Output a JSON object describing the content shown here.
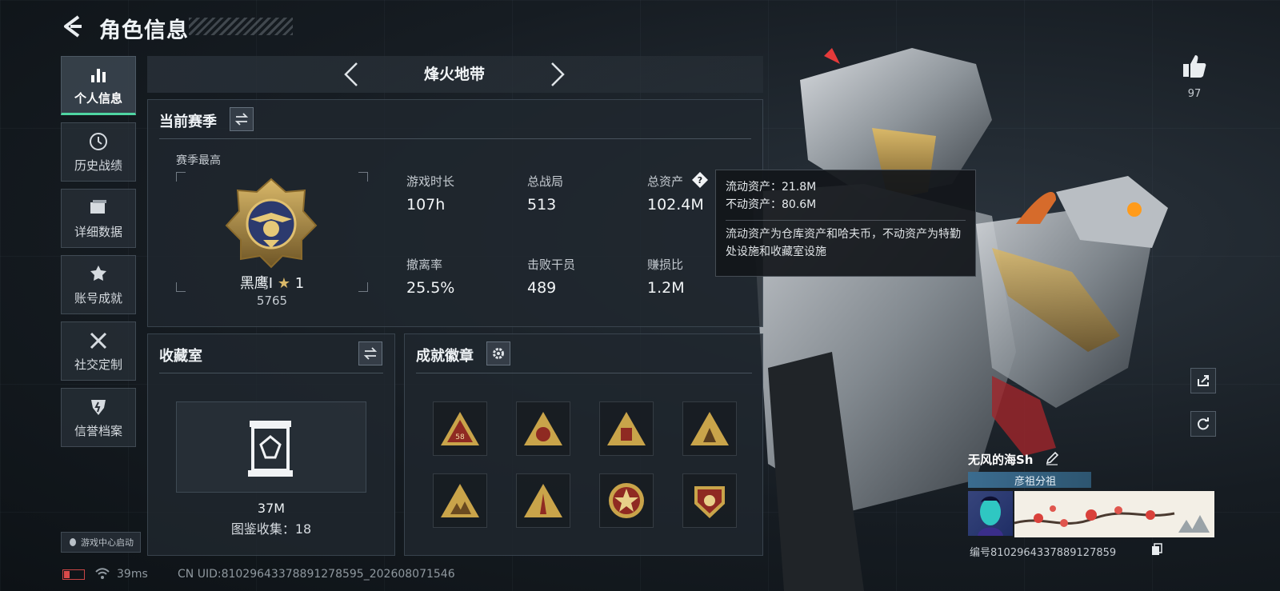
{
  "header": {
    "title": "角色信息"
  },
  "sidebar": {
    "items": [
      {
        "label": "个人信息",
        "icon": "bar-chart-icon",
        "active": true
      },
      {
        "label": "历史战绩",
        "icon": "clock-icon"
      },
      {
        "label": "详细数据",
        "icon": "folder-icon"
      },
      {
        "label": "账号成就",
        "icon": "medal-icon"
      },
      {
        "label": "社交定制",
        "icon": "tools-icon"
      },
      {
        "label": "信誉档案",
        "icon": "shield-icon"
      }
    ],
    "launch_label": "游戏中心启动"
  },
  "mode": {
    "title": "烽火地带"
  },
  "season": {
    "title": "当前赛季",
    "subtitle": "赛季最高",
    "rank_name": "黑鹰I",
    "rank_stars": "1",
    "rank_points": "5765"
  },
  "stats": [
    {
      "label": "游戏时长",
      "value": "107h"
    },
    {
      "label": "总战局",
      "value": "513"
    },
    {
      "label": "总资产",
      "value": "102.4M"
    },
    {
      "label": "撤离率",
      "value": "25.5%"
    },
    {
      "label": "击败干员",
      "value": "489"
    },
    {
      "label": "赚损比",
      "value": "1.2M"
    }
  ],
  "tooltip": {
    "liquid": "流动资产：21.8M",
    "fixed": "不动资产：80.6M",
    "note": "流动资产为仓库资产和哈夫币，不动资产为特勤处设施和收藏室设施"
  },
  "collection": {
    "title": "收藏室",
    "value": "37M",
    "count": "图鉴收集：18"
  },
  "badges": {
    "title": "成就徽章",
    "items": [
      "badge-1",
      "badge-2",
      "badge-3",
      "badge-4",
      "badge-5",
      "badge-6",
      "badge-7",
      "badge-8"
    ],
    "badge_58_label": "58"
  },
  "social": {
    "likes": "97"
  },
  "player": {
    "name": "无风的海Sh",
    "clan": "彦祖分祖",
    "id": "编号8102964337889127859"
  },
  "footer": {
    "ping": "39ms",
    "uid": "CN UID:81029643378891278595_202608071546"
  },
  "colors": {
    "accent": "#4fd6a2",
    "gold": "#c9a44a",
    "tooltip_bg": "#12161a"
  }
}
